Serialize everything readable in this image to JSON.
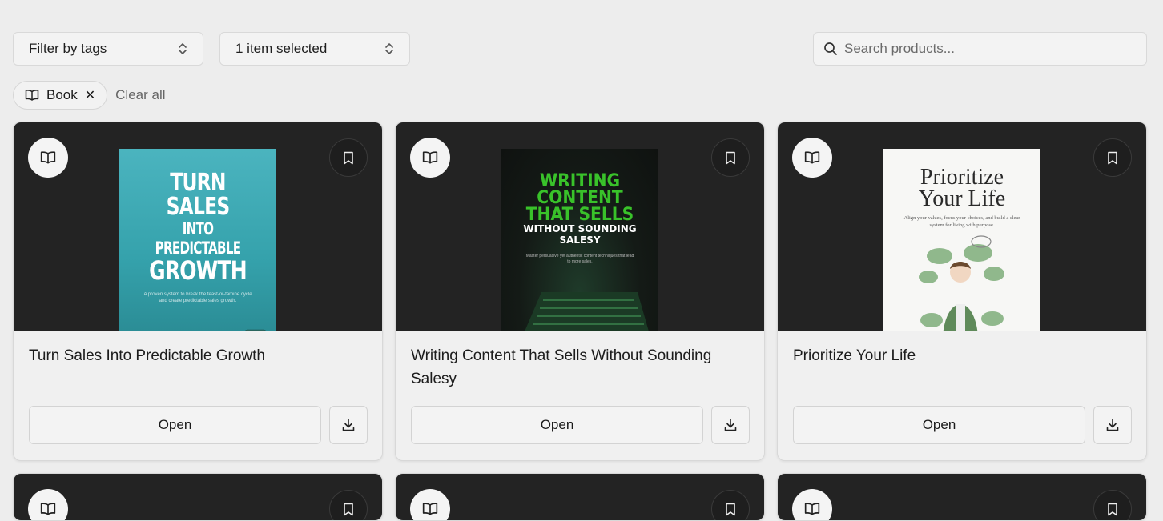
{
  "filters": {
    "tags_select": "Filter by tags",
    "items_select": "1 item selected",
    "search_placeholder": "Search products..."
  },
  "active_tags": {
    "chips": [
      {
        "label": "Book",
        "icon": "book-icon"
      }
    ],
    "clear_label": "Clear all"
  },
  "products": [
    {
      "title": "Turn Sales Into Predictable Growth",
      "open_label": "Open",
      "type_icon": "book-icon",
      "cover": {
        "line1": "TURN SALES",
        "line2": "INTO PREDICTABLE",
        "line3": "GROWTH",
        "subtitle": "A proven system to break the feast-or-famine cycle and create predictable sales growth."
      }
    },
    {
      "title": "Writing Content That Sells Without Sounding Salesy",
      "open_label": "Open",
      "type_icon": "book-icon",
      "cover": {
        "line1": "WRITING",
        "line2": "CONTENT",
        "line3": "THAT SELLS",
        "line4": "WITHOUT SOUNDING",
        "line5": "SALESY",
        "subtitle": "Master persuasive yet authentic content techniques that lead to more sales."
      }
    },
    {
      "title": "Prioritize Your Life",
      "open_label": "Open",
      "type_icon": "book-icon",
      "cover": {
        "line1": "Prioritize",
        "line2": "Your Life",
        "subtitle": "Align your values, focus your choices, and build a clear system for living with purpose."
      }
    }
  ],
  "colors": {
    "page_bg": "#ededed",
    "card_hero_bg": "#232323",
    "cover1_bg": "#3aa6b0",
    "cover2_accent": "#39c22a",
    "cover3_bg": "#f7f7f5"
  }
}
